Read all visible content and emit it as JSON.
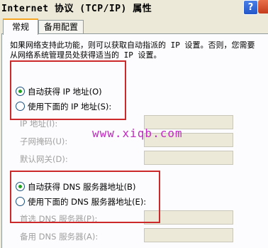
{
  "window": {
    "title": "Internet 协议 (TCP/IP) 属性",
    "help_label": "?"
  },
  "tabs": [
    {
      "label": "常规"
    },
    {
      "label": "备用配置"
    }
  ],
  "description": "如果网络支持此功能，则可以获取自动指派的 IP 设置。否则，您需要从网络系统管理员处获得适当的 IP 设置。",
  "ip_section": {
    "auto_label": "自动获得 IP 地址(O)",
    "manual_label": "使用下面的 IP 地址(S):",
    "fields": [
      {
        "label": "IP 地址(I):",
        "value": ""
      },
      {
        "label": "子网掩码(U):",
        "value": ""
      },
      {
        "label": "默认网关(D):",
        "value": ""
      }
    ]
  },
  "dns_section": {
    "auto_label": "自动获得 DNS 服务器地址(B)",
    "manual_label": "使用下面的 DNS 服务器地址(E):",
    "fields": [
      {
        "label": "首选 DNS 服务器(P):",
        "value": ""
      },
      {
        "label": "备用 DNS 服务器(A):",
        "value": ""
      }
    ]
  },
  "watermark": "www.xiqb.com",
  "colors": {
    "highlight": "#cc2a2a",
    "watermark": "#c02bc0",
    "radio_dot": "#21a121"
  }
}
